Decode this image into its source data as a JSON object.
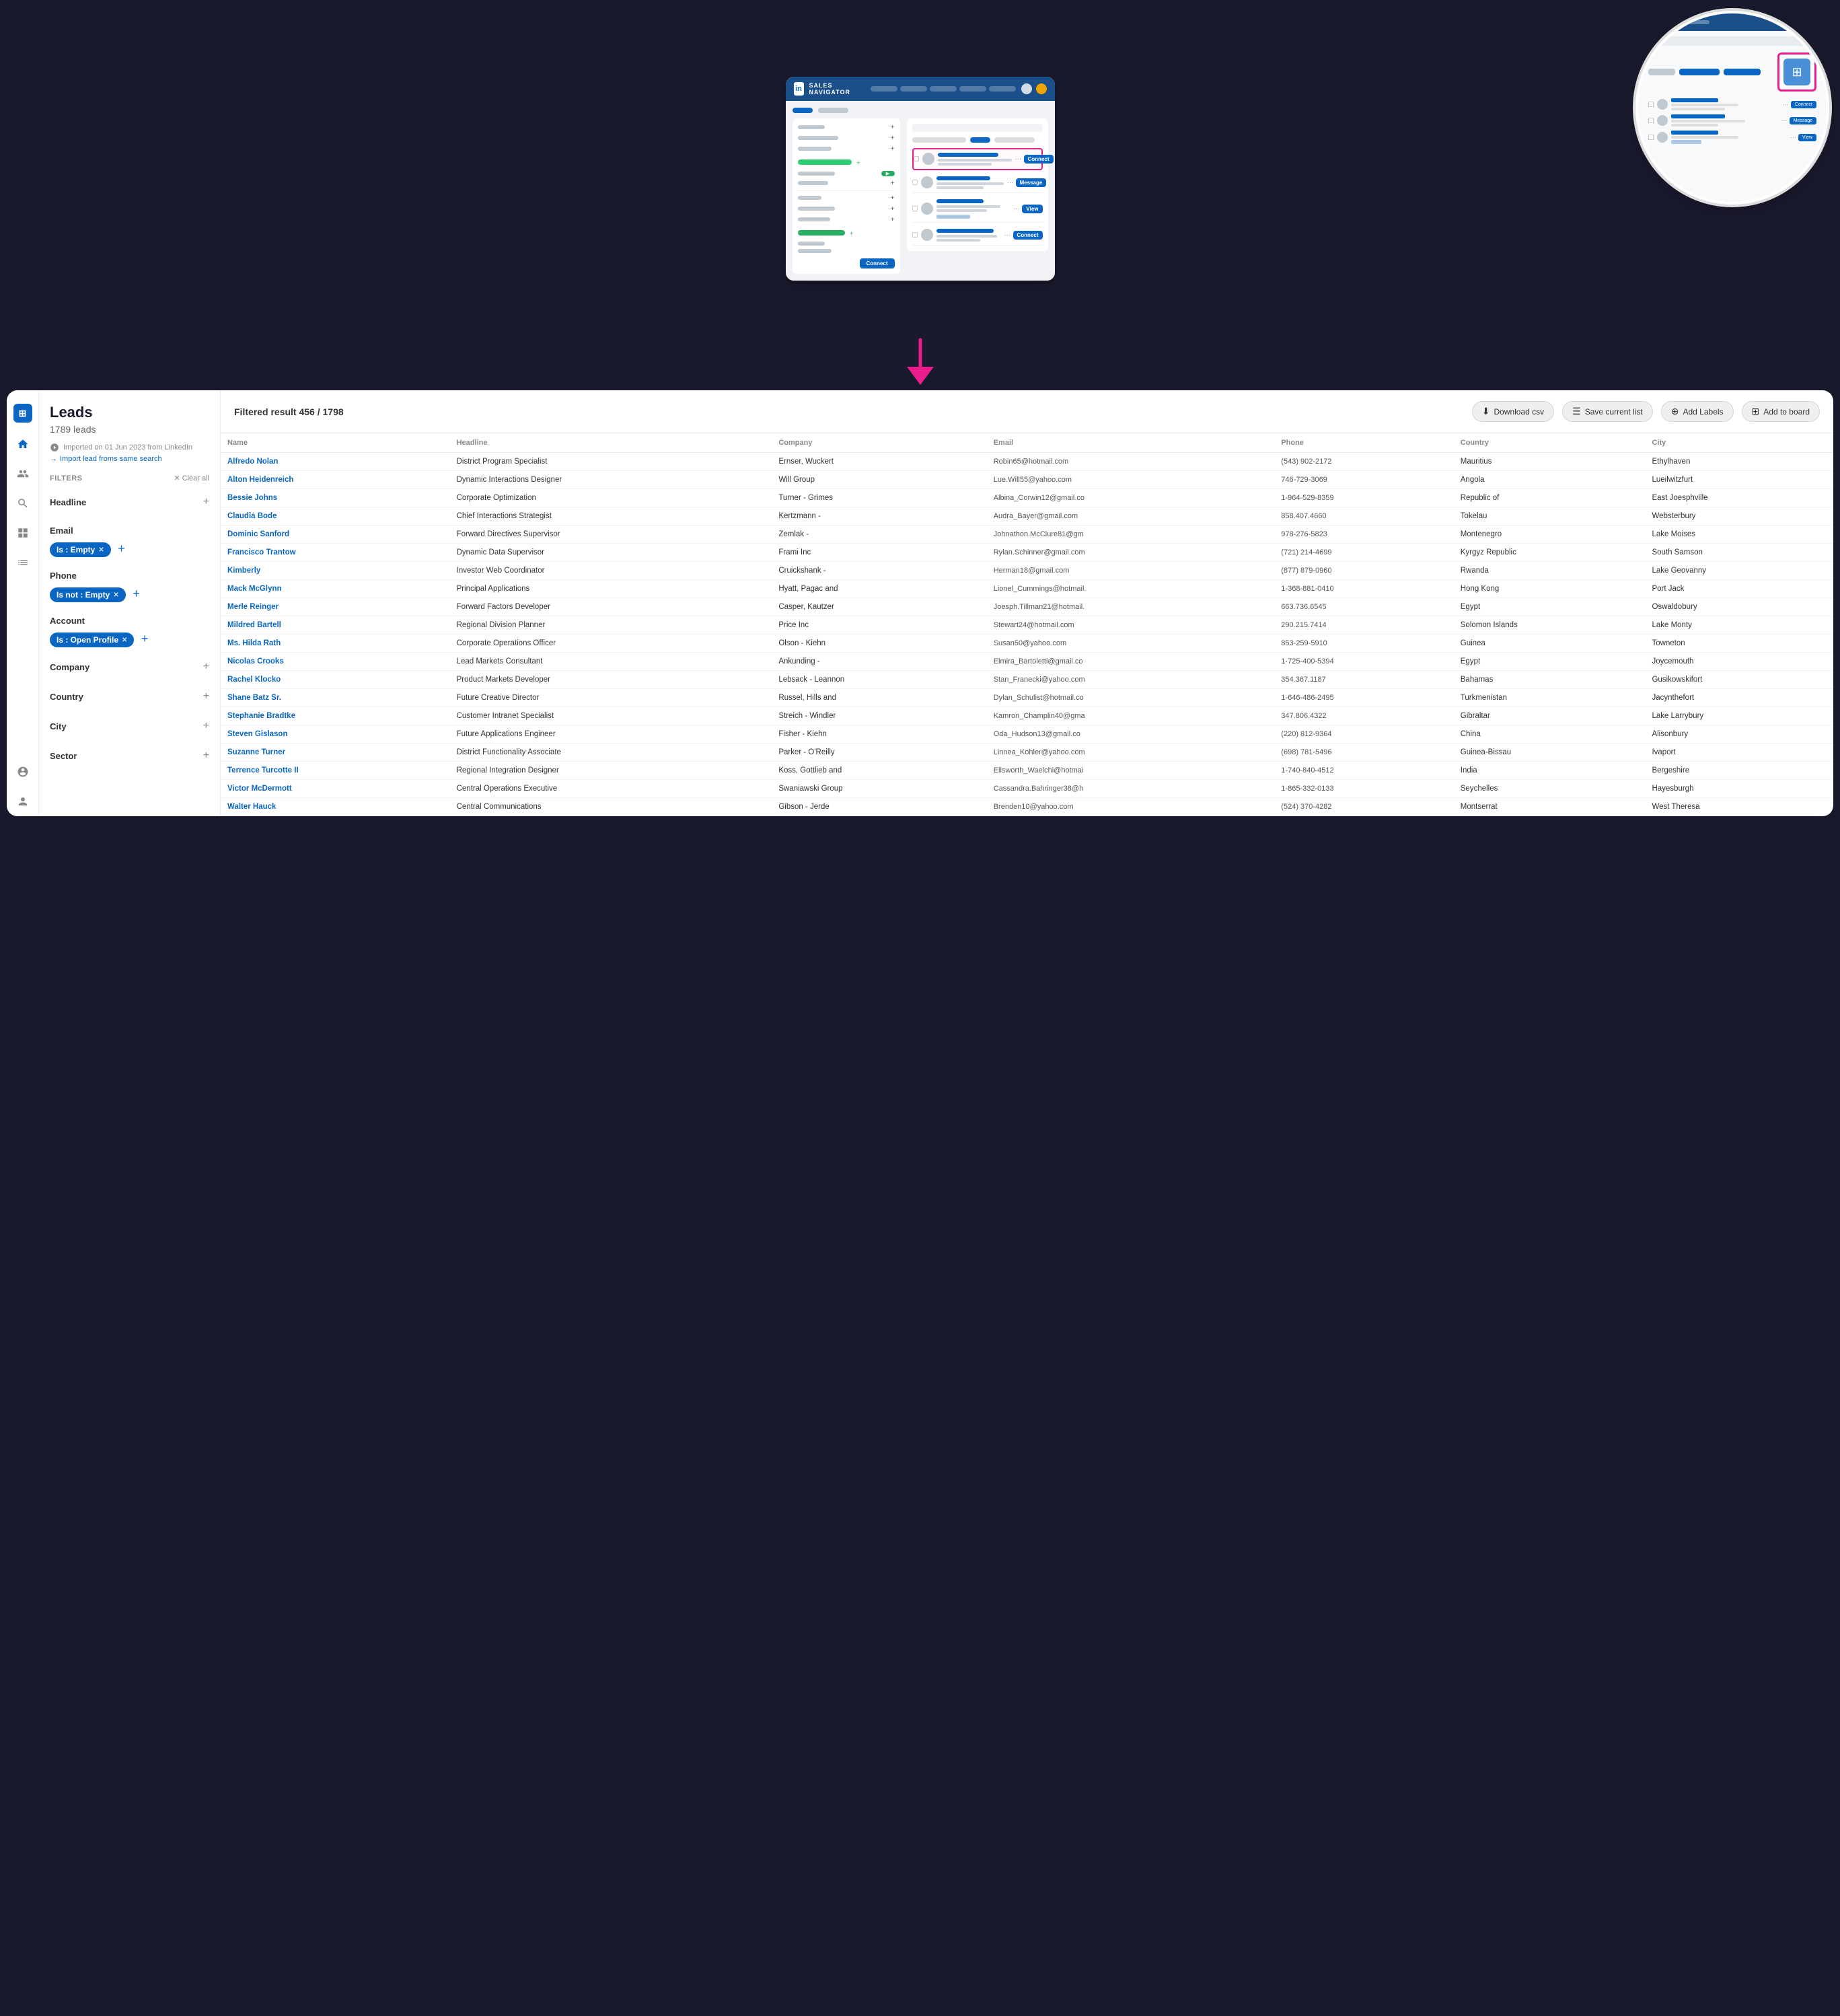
{
  "top": {
    "browser": {
      "logo": "in",
      "title": "SALES NAVIGATOR",
      "nav_pills": [
        "",
        "",
        "",
        "",
        ""
      ],
      "zoomed_icon_label": "grid-icon"
    },
    "arrow_char": "↓"
  },
  "bottom": {
    "sidebar": {
      "title": "Leads",
      "count": "1789 leads",
      "import_date": "Imported on 01 Jun 2023 from LinkedIn",
      "import_link": "Import lead froms same search",
      "filters_label": "FILTERS",
      "clear_label": "Clear all",
      "sections": [
        {
          "name": "Headline",
          "filter": null
        },
        {
          "name": "Email",
          "filter": "Is : Empty"
        },
        {
          "name": "Phone",
          "filter": "Is not : Empty"
        },
        {
          "name": "Account",
          "filter": "Is : Open Profile"
        },
        {
          "name": "Company",
          "filter": null
        },
        {
          "name": "Country",
          "filter": null
        },
        {
          "name": "City",
          "filter": null
        },
        {
          "name": "Sector",
          "filter": null
        }
      ]
    },
    "toolbar": {
      "filtered_result": "Filtered result 456 / 1798",
      "download_csv": "Download csv",
      "save_current_list": "Save current list",
      "add_labels": "Add Labels",
      "add_to_board": "Add to board"
    },
    "table": {
      "columns": [
        "Name",
        "Headline",
        "Company",
        "Email",
        "Phone",
        "Country",
        "City"
      ],
      "rows": [
        {
          "name": "Alfredo Nolan",
          "headline": "District Program Specialist",
          "company": "Ernser, Wuckert",
          "email": "Robin65@hotmail.com",
          "phone": "(543) 902-2172",
          "country": "Mauritius",
          "city": "Ethylhaven"
        },
        {
          "name": "Alton Heidenreich",
          "headline": "Dynamic Interactions Designer",
          "company": "Will Group",
          "email": "Lue.Will55@yahoo.com",
          "phone": "746-729-3069",
          "country": "Angola",
          "city": "Lueilwitzfurt"
        },
        {
          "name": "Bessie Johns",
          "headline": "Corporate Optimization",
          "company": "Turner - Grimes",
          "email": "Albina_Corwin12@gmail.co",
          "phone": "1-964-529-8359",
          "country": "Republic of",
          "city": "East Joesphville"
        },
        {
          "name": "Claudia Bode",
          "headline": "Chief Interactions Strategist",
          "company": "Kertzmann -",
          "email": "Audra_Bayer@gmail.com",
          "phone": "858.407.4660",
          "country": "Tokelau",
          "city": "Websterbury"
        },
        {
          "name": "Dominic Sanford",
          "headline": "Forward Directives Supervisor",
          "company": "Zemlak -",
          "email": "Johnathon.McClure81@gm",
          "phone": "978-276-5823",
          "country": "Montenegro",
          "city": "Lake Moises"
        },
        {
          "name": "Francisco Trantow",
          "headline": "Dynamic Data Supervisor",
          "company": "Frami Inc",
          "email": "Rylan.Schinner@gmail.com",
          "phone": "(721) 214-4699",
          "country": "Kyrgyz Republic",
          "city": "South Samson"
        },
        {
          "name": "Kimberly",
          "headline": "Investor Web Coordinator",
          "company": "Cruickshank -",
          "email": "Herman18@gmail.com",
          "phone": "(877) 879-0960",
          "country": "Rwanda",
          "city": "Lake Geovanny"
        },
        {
          "name": "Mack McGlynn",
          "headline": "Principal Applications",
          "company": "Hyatt, Pagac and",
          "email": "Lionel_Cummings@hotmail.",
          "phone": "1-368-881-0410",
          "country": "Hong Kong",
          "city": "Port Jack"
        },
        {
          "name": "Merle Reinger",
          "headline": "Forward Factors Developer",
          "company": "Casper, Kautzer",
          "email": "Joesph.Tillman21@hotmail.",
          "phone": "663.736.6545",
          "country": "Egypt",
          "city": "Oswaldobury"
        },
        {
          "name": "Mildred Bartell",
          "headline": "Regional Division Planner",
          "company": "Price Inc",
          "email": "Stewart24@hotmail.com",
          "phone": "290.215.7414",
          "country": "Solomon Islands",
          "city": "Lake Monty"
        },
        {
          "name": "Ms. Hilda Rath",
          "headline": "Corporate Operations Officer",
          "company": "Olson - Kiehn",
          "email": "Susan50@yahoo.com",
          "phone": "853-259-5910",
          "country": "Guinea",
          "city": "Towneton"
        },
        {
          "name": "Nicolas Crooks",
          "headline": "Lead Markets Consultant",
          "company": "Ankunding -",
          "email": "Elmira_Bartoletti@gmail.co",
          "phone": "1-725-400-5394",
          "country": "Egypt",
          "city": "Joycemouth"
        },
        {
          "name": "Rachel Klocko",
          "headline": "Product Markets Developer",
          "company": "Lebsack - Leannon",
          "email": "Stan_Franecki@yahoo.com",
          "phone": "354.367.1187",
          "country": "Bahamas",
          "city": "Gusikowskifort"
        },
        {
          "name": "Shane Batz Sr.",
          "headline": "Future Creative Director",
          "company": "Russel, Hills and",
          "email": "Dylan_Schulist@hotmail.co",
          "phone": "1-646-486-2495",
          "country": "Turkmenistan",
          "city": "Jacynthefort"
        },
        {
          "name": "Stephanie Bradtke",
          "headline": "Customer Intranet Specialist",
          "company": "Streich - Windler",
          "email": "Kamron_Champlin40@gma",
          "phone": "347.806.4322",
          "country": "Gibraltar",
          "city": "Lake Larrybury"
        },
        {
          "name": "Steven Gislason",
          "headline": "Future Applications Engineer",
          "company": "Fisher - Kiehn",
          "email": "Oda_Hudson13@gmail.co",
          "phone": "(220) 812-9364",
          "country": "China",
          "city": "Alisonbury"
        },
        {
          "name": "Suzanne Turner",
          "headline": "District Functionality Associate",
          "company": "Parker - O'Reilly",
          "email": "Linnea_Kohler@yahoo.com",
          "phone": "(698) 781-5496",
          "country": "Guinea-Bissau",
          "city": "Ivaport"
        },
        {
          "name": "Terrence Turcotte II",
          "headline": "Regional Integration Designer",
          "company": "Koss, Gottlieb and",
          "email": "Ellsworth_Waelchi@hotmai",
          "phone": "1-740-840-4512",
          "country": "India",
          "city": "Bergeshire"
        },
        {
          "name": "Victor McDermott",
          "headline": "Central Operations Executive",
          "company": "Swaniawski Group",
          "email": "Cassandra.Bahringer38@h",
          "phone": "1-865-332-0133",
          "country": "Seychelles",
          "city": "Hayesburgh"
        },
        {
          "name": "Walter Hauck",
          "headline": "Central Communications",
          "company": "Gibson - Jerde",
          "email": "Brenden10@yahoo.com",
          "phone": "(524) 370-4282",
          "country": "Montserrat",
          "city": "West Theresa"
        }
      ]
    }
  }
}
